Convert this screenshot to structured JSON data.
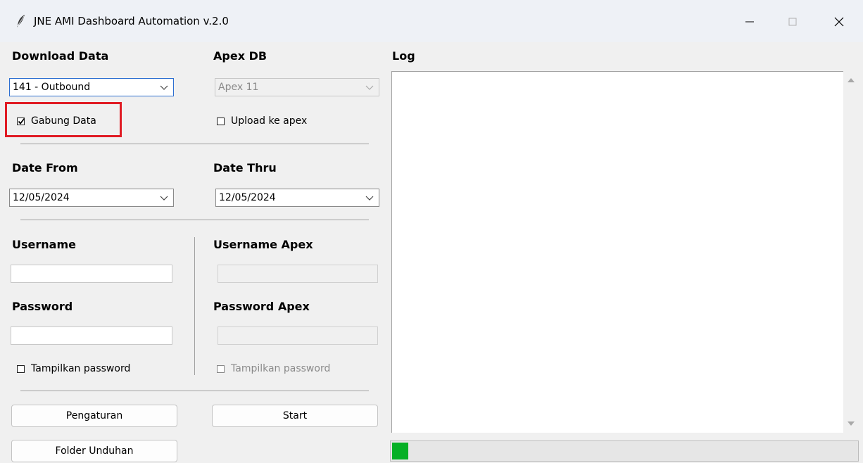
{
  "window": {
    "title": "JNE AMI Dashboard Automation v.2.0"
  },
  "left": {
    "download_data_label": "Download Data",
    "download_data_value": "141 - Outbound",
    "gabung_data_label": "Gabung Data",
    "gabung_data_checked": true,
    "date_from_label": "Date From",
    "date_from_value": "12/05/2024",
    "username_label": "Username",
    "username_value": "",
    "password_label": "Password",
    "password_value": "",
    "show_password_label": "Tampilkan password",
    "show_password_checked": false,
    "settings_button": "Pengaturan",
    "download_folder_button": "Folder Unduhan"
  },
  "middle": {
    "apex_db_label": "Apex DB",
    "apex_db_value": "Apex 11",
    "upload_apex_label": "Upload ke apex",
    "upload_apex_checked": false,
    "date_thru_label": "Date Thru",
    "date_thru_value": "12/05/2024",
    "username_apex_label": "Username Apex",
    "password_apex_label": "Password Apex",
    "show_password_apex_label": "Tampilkan password",
    "start_button": "Start"
  },
  "log": {
    "label": "Log",
    "content": ""
  },
  "progress": {
    "percent": 3.5,
    "color": "#06b025"
  },
  "colors": {
    "highlight": "#e01b24",
    "focus_border": "#2d6fd1"
  }
}
